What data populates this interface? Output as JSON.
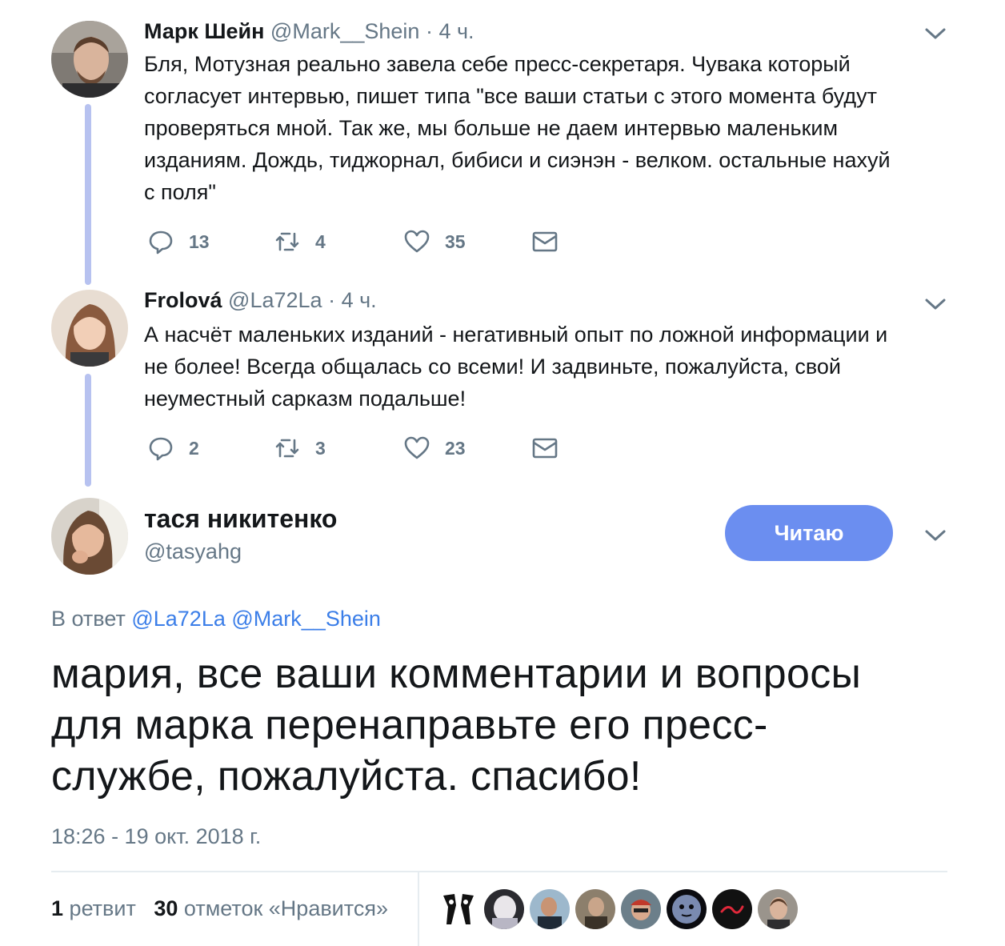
{
  "thread": [
    {
      "name": "Марк Шейн",
      "handle": "@Mark__Shein",
      "separator": "·",
      "time": "4 ч.",
      "text_lines": [
        "Бля, Мотузная реально завела себе пресс-секретаря. Чувака который",
        "согласует интервью, пишет типа \"все ваши статьи с этого момента будут",
        "проверяться мной. Так же, мы больше не даем интервью маленьким",
        "изданиям. Дождь, тиджорнал, бибиси и сиэнэн - велком. остальные нахуй",
        "с поля\""
      ],
      "replies": "13",
      "retweets": "4",
      "likes": "35",
      "icons": {
        "avatar": "avatar-photo",
        "reply": "reply-icon",
        "retweet": "retweet-icon",
        "like": "heart-icon",
        "dm": "envelope-icon",
        "menu": "chevron-down-icon"
      }
    },
    {
      "name": "Frolová",
      "handle": "@La72La",
      "separator": "·",
      "time": "4 ч.",
      "text_lines": [
        "А насчёт маленьких изданий - негативный опыт по ложной информации и",
        "не более! Всегда общалась со всеми! И задвиньте, пожалуйста, свой",
        "неуместный сарказм подальше!"
      ],
      "replies": "2",
      "retweets": "3",
      "likes": "23"
    }
  ],
  "main_tweet": {
    "name": "тася никитенко",
    "handle": "@tasyahg",
    "follow_label": "Читаю",
    "reply_prefix": "В ответ",
    "mention_1": "@La72La",
    "mention_2": "@Mark__Shein",
    "text_lines": [
      "мария, все ваши комментарии и вопросы",
      "для марка перенаправьте его пресс-",
      "службе, пожалуйста. спасибо!"
    ],
    "timestamp": "18:26 - 19 окт. 2018 г.",
    "retweet_count": "1",
    "retweet_label": "ретвит",
    "like_count": "30",
    "like_label": "отметок «Нравится»"
  },
  "colors": {
    "accent": "#6b8ef0",
    "mention": "#3b7ee8",
    "muted": "#657786",
    "thread_line": "#b7c2f0"
  }
}
